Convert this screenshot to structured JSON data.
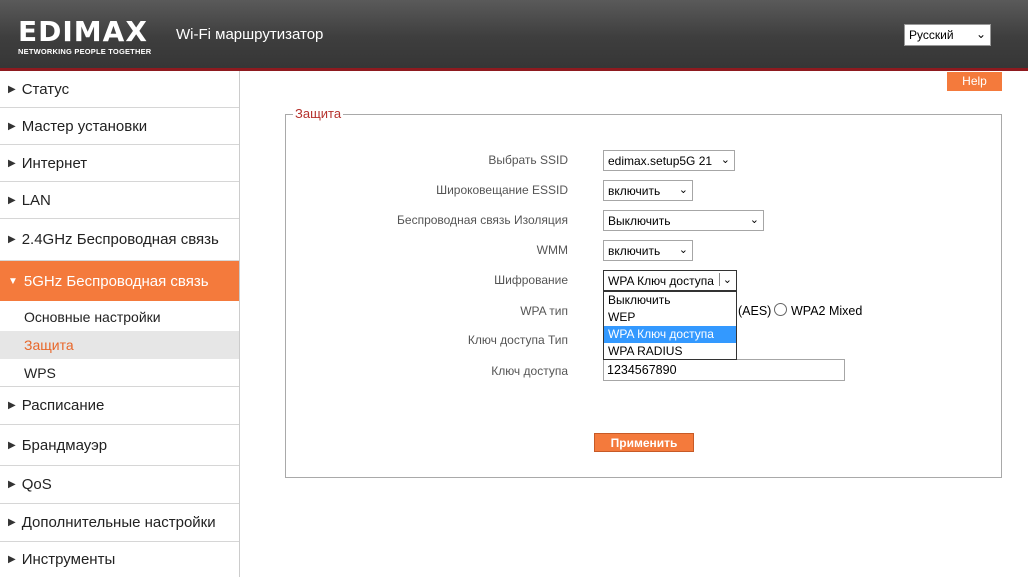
{
  "header": {
    "logo_text": "EDIMAX",
    "logo_tagline": "NETWORKING PEOPLE TOGETHER",
    "title": "Wi-Fi маршрутизатор",
    "language": "Русский",
    "colors": {
      "header_bg": "#3e3e3e",
      "accent": "#f47a3c",
      "underline": "#8e1a1f"
    }
  },
  "sidebar": {
    "items": [
      {
        "label": "Статус"
      },
      {
        "label": "Мастер установки"
      },
      {
        "label": "Интернет"
      },
      {
        "label": "LAN"
      },
      {
        "label": "2.4GHz Беспроводная связь"
      },
      {
        "label": "5GHz Беспроводная связь",
        "expanded": true
      },
      {
        "label": "Расписание"
      },
      {
        "label": "Брандмауэр"
      },
      {
        "label": "QoS"
      },
      {
        "label": "Дополнительные настройки"
      },
      {
        "label": "Инструменты"
      }
    ],
    "subitems": [
      {
        "label": "Основные настройки"
      },
      {
        "label": "Защита",
        "selected": true
      },
      {
        "label": "WPS"
      }
    ]
  },
  "main": {
    "help_label": "Help",
    "panel_title": "Защита",
    "fields": {
      "ssid": {
        "label": "Выбрать SSID",
        "value": "edimax.setup5G 21"
      },
      "broadcast": {
        "label": "Широковещание ESSID",
        "value": "включить"
      },
      "isolation": {
        "label": "Беспроводная связь Изоляция",
        "value": "Выключить"
      },
      "wmm": {
        "label": "WMM",
        "value": "включить"
      },
      "encryption": {
        "label": "Шифрование",
        "value": "WPA Ключ доступа",
        "options": [
          "Выключить",
          "WEP",
          "WPA Ключ доступа",
          "WPA RADIUS"
        ],
        "highlighted": "WPA Ключ доступа"
      },
      "wpa_type": {
        "label": "WPA тип",
        "visible_option_tail": "(AES)",
        "option_mixed": "WPA2 Mixed"
      },
      "key_type": {
        "label": "Ключ доступа Тип"
      },
      "key": {
        "label": "Ключ доступа",
        "value": "1234567890"
      }
    },
    "apply_label": "Применить"
  }
}
